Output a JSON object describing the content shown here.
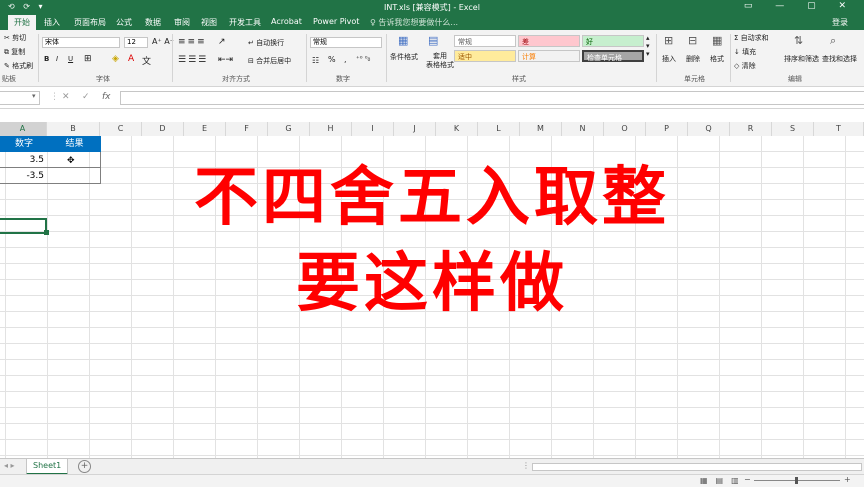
{
  "titlebar": {
    "title": "INT.xls [兼容模式] - Excel",
    "quick_access": "⟲ ⟳ ▾",
    "window_controls": "▭ — ▢ ✕"
  },
  "tabs": [
    "开始",
    "插入",
    "页面布局",
    "公式",
    "数据",
    "审阅",
    "视图",
    "开发工具",
    "Acrobat",
    "Power Pivot"
  ],
  "tell_me": "告诉我您想要做什么...",
  "login": "登录",
  "ribbon": {
    "clipboard": {
      "cut": "剪切",
      "copy": "复制",
      "format_painter": "格式刷",
      "label": "贴板"
    },
    "font": {
      "name": "宋体",
      "size": "12",
      "bold": "B",
      "italic": "I",
      "underline": "U",
      "label": "字体"
    },
    "alignment": {
      "wrap": "自动换行",
      "merge": "合并后居中",
      "label": "对齐方式"
    },
    "number": {
      "format": "常规",
      "percent": "%",
      "comma": ",",
      "label": "数字"
    },
    "styles": {
      "conditional": "条件格式",
      "table_format": "套用\n表格格式",
      "cells": [
        "常规",
        "差",
        "好",
        "适中",
        "计算",
        "检查单元格"
      ],
      "label": "样式"
    },
    "cells_group": {
      "insert": "插入",
      "delete": "删除",
      "format": "格式",
      "label": "单元格"
    },
    "editing": {
      "autosum": "自动求和",
      "fill": "填充",
      "clear": "清除",
      "sort": "排序和筛选",
      "find": "查找和选择",
      "label": "编辑"
    }
  },
  "formula_bar": {
    "cancel": "✕",
    "enter": "✓",
    "fx": "fx",
    "value": ""
  },
  "columns": [
    "A",
    "B",
    "C",
    "D",
    "E",
    "F",
    "G",
    "H",
    "I",
    "J",
    "K",
    "L",
    "M",
    "N",
    "O",
    "P",
    "Q",
    "R",
    "S",
    "T"
  ],
  "table": {
    "headers": [
      "数字",
      "结果"
    ],
    "rows": [
      [
        "3.5",
        ""
      ],
      [
        "-3.5",
        ""
      ]
    ]
  },
  "overlay": {
    "line1": "不四舍五入取整",
    "line2": "要这样做"
  },
  "sheets": [
    "Sheet1"
  ],
  "colors": {
    "excel_green": "#217346",
    "header_blue": "#0070c0",
    "overlay_red": "#ff0000"
  }
}
